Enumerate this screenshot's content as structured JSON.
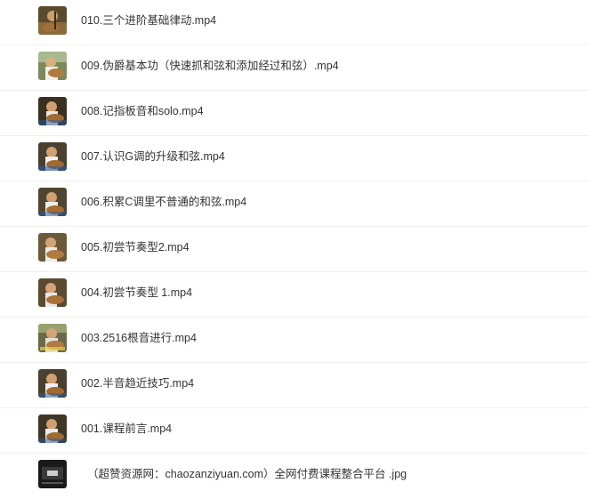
{
  "files": [
    {
      "name": "010.三个进阶基础律动.mp4",
      "type": "video",
      "icon": "video-thumbnail-icon"
    },
    {
      "name": "009.伪爵基本功（快速抓和弦和添加经过和弦）.mp4",
      "type": "video",
      "icon": "video-thumbnail-icon"
    },
    {
      "name": "008.记指板音和solo.mp4",
      "type": "video",
      "icon": "video-thumbnail-icon"
    },
    {
      "name": "007.认识G调的升级和弦.mp4",
      "type": "video",
      "icon": "video-thumbnail-icon"
    },
    {
      "name": "006.积累C调里不普通的和弦.mp4",
      "type": "video",
      "icon": "video-thumbnail-icon"
    },
    {
      "name": "005.初尝节奏型2.mp4",
      "type": "video",
      "icon": "video-thumbnail-icon"
    },
    {
      "name": "004.初尝节奏型 1.mp4",
      "type": "video",
      "icon": "video-thumbnail-icon"
    },
    {
      "name": "003.2516根音进行.mp4",
      "type": "video",
      "icon": "video-thumbnail-icon"
    },
    {
      "name": "002.半音趋近技巧.mp4",
      "type": "video",
      "icon": "video-thumbnail-icon"
    },
    {
      "name": "001.课程前言.mp4",
      "type": "video",
      "icon": "video-thumbnail-icon"
    },
    {
      "name": "（超赞资源网：chaozanziyuan.com）全网付费课程整合平台 .jpg",
      "type": "image",
      "icon": "image-thumbnail-icon"
    }
  ],
  "colors": {
    "text": "#333333",
    "divider": "#f0f0f0",
    "background": "#ffffff"
  }
}
